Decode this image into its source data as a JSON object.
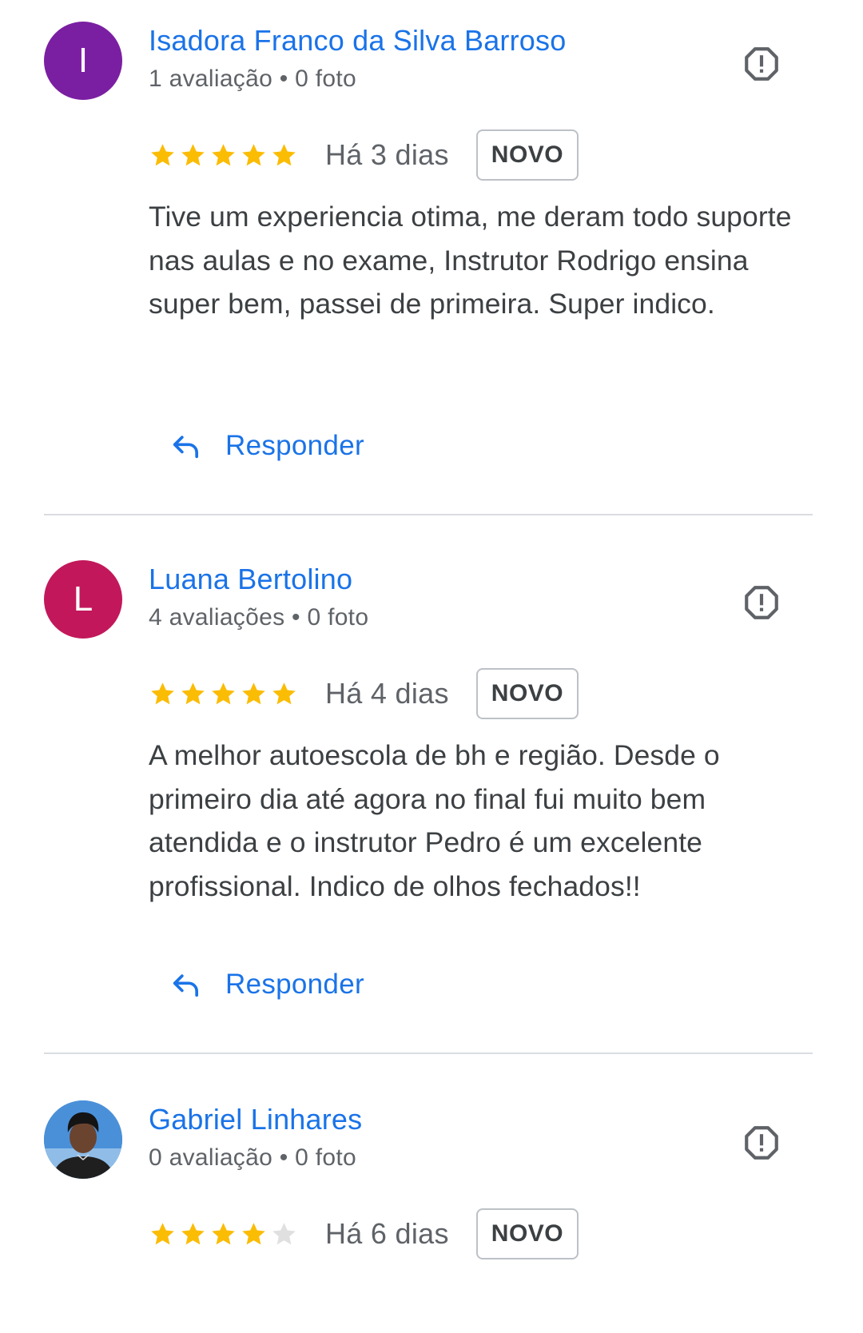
{
  "reviews": [
    {
      "avatar_letter": "I",
      "avatar_color": "#7b1fa2",
      "name": "Isadora Franco da Silva Barroso",
      "meta": "1 avaliação • 0 foto",
      "rating": 5,
      "date": "Há 3 dias",
      "badge": "NOVO",
      "text": "Tive um experiencia otima, me deram todo suporte nas aulas e no exame, Instrutor Rodrigo ensina super bem, passei de primeira. Super indico.",
      "reply_label": "Responder"
    },
    {
      "avatar_letter": "L",
      "avatar_color": "#c2185b",
      "name": "Luana Bertolino",
      "meta": "4 avaliações • 0 foto",
      "rating": 5,
      "date": "Há 4 dias",
      "badge": "NOVO",
      "text": "A melhor autoescola de bh e região. Desde o primeiro dia até agora no final fui muito bem atendida e o instrutor Pedro é um excelente profissional. Indico de olhos fechados!!",
      "reply_label": "Responder"
    },
    {
      "avatar_letter": "",
      "avatar_color": "#2e78c8",
      "name": "Gabriel Linhares",
      "meta": "0 avaliação • 0 foto",
      "rating": 4,
      "date": "Há 6 dias",
      "badge": "NOVO"
    }
  ],
  "icons": {
    "flag": "report-flag-icon",
    "reply": "reply-arrow-icon",
    "star": "star-icon"
  },
  "colors": {
    "link": "#1a73e8",
    "star_filled": "#fbbc04",
    "star_empty": "#e0e0e0"
  }
}
